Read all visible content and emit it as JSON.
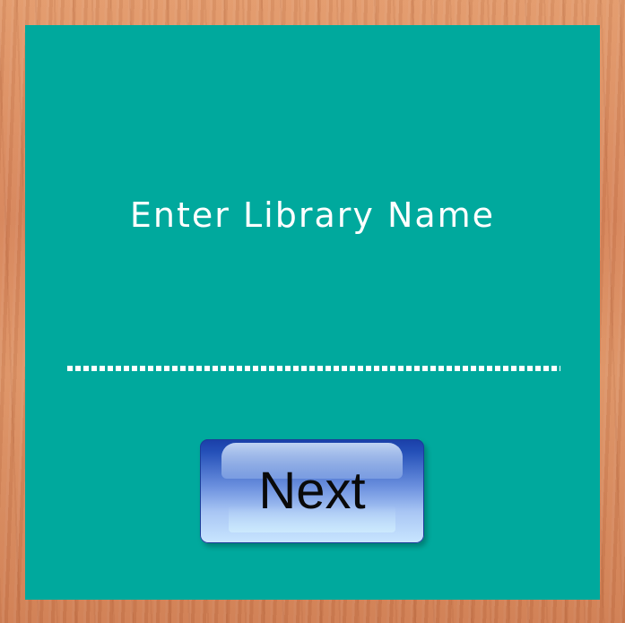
{
  "screen": {
    "title": "Enter Library Name"
  },
  "library_name_input": {
    "value": "",
    "placeholder": ""
  },
  "next_button": {
    "label": "Next"
  },
  "colors": {
    "panel": "#00a99d",
    "background_wood": "#d98a5a",
    "button_blue": "#2450b8",
    "text": "#ffffff"
  }
}
